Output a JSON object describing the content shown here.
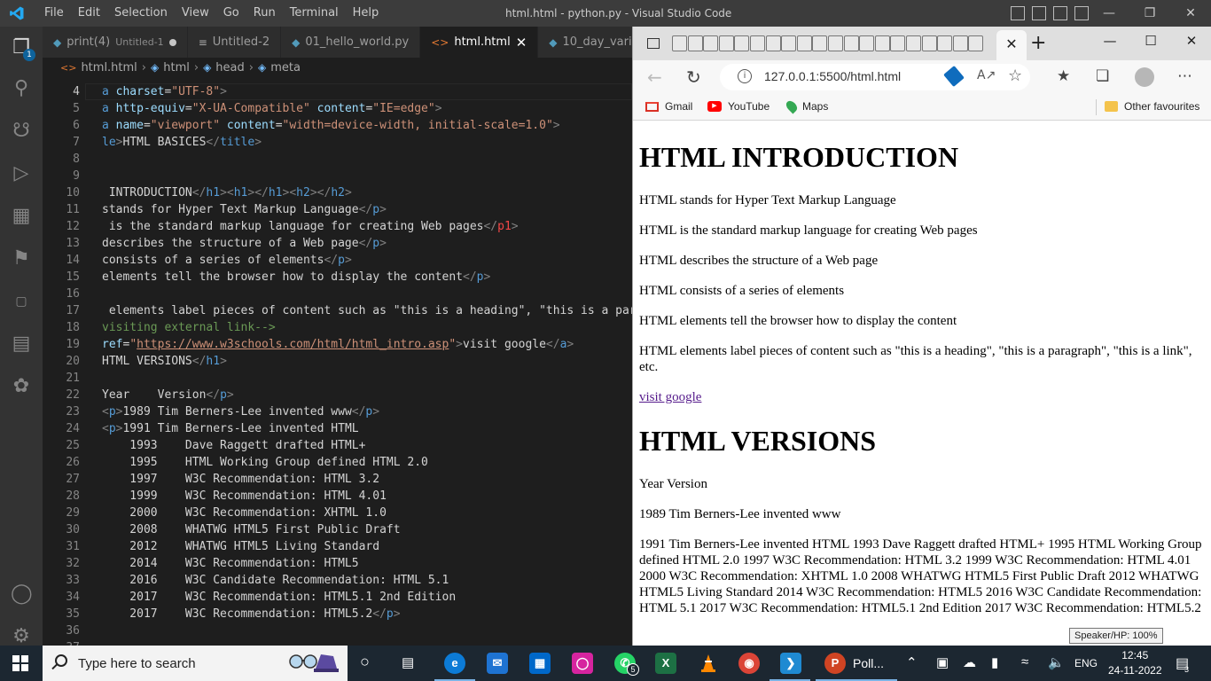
{
  "vscode": {
    "menu": [
      "File",
      "Edit",
      "Selection",
      "View",
      "Go",
      "Run",
      "Terminal",
      "Help"
    ],
    "window_title": "html.html - python.py - Visual Studio Code",
    "explorer_badge": "1",
    "tabs": [
      {
        "icon": "python-file-icon",
        "label": "print(4)",
        "sub": "Untitled-1",
        "state": "modified"
      },
      {
        "icon": "text-file-icon",
        "label": "Untitled-2"
      },
      {
        "icon": "python-file-icon",
        "label": "01_hello_world.py"
      },
      {
        "icon": "html-file-icon",
        "label": "html.html",
        "state": "active"
      },
      {
        "icon": "python-file-icon",
        "label": "10_day_vari"
      }
    ],
    "breadcrumb": [
      "html.html",
      "html",
      "head",
      "meta"
    ],
    "code_lines": [
      {
        "n": "4",
        "parts": [
          [
            "a",
            "t-name"
          ],
          [
            " charset",
            "t-attr"
          ],
          [
            "=",
            ""
          ],
          [
            "\"UTF-8\"",
            "t-str"
          ],
          [
            ">",
            "t-tag"
          ]
        ]
      },
      {
        "n": "5",
        "parts": [
          [
            "a",
            "t-name"
          ],
          [
            " http-equiv",
            "t-attr"
          ],
          [
            "=",
            ""
          ],
          [
            "\"X-UA-Compatible\"",
            "t-str"
          ],
          [
            " content",
            "t-attr"
          ],
          [
            "=",
            ""
          ],
          [
            "\"IE=edge\"",
            "t-str"
          ],
          [
            ">",
            "t-tag"
          ]
        ]
      },
      {
        "n": "6",
        "parts": [
          [
            "a",
            "t-name"
          ],
          [
            " name",
            "t-attr"
          ],
          [
            "=",
            ""
          ],
          [
            "\"viewport\"",
            "t-str"
          ],
          [
            " content",
            "t-attr"
          ],
          [
            "=",
            ""
          ],
          [
            "\"width=device-width, initial-scale=1.0\"",
            "t-str"
          ],
          [
            ">",
            "t-tag"
          ]
        ]
      },
      {
        "n": "7",
        "parts": [
          [
            "le",
            "t-name"
          ],
          [
            ">",
            "t-tag"
          ],
          [
            "HTML BASICES",
            ""
          ],
          [
            "</",
            "t-tag"
          ],
          [
            "title",
            "t-name"
          ],
          [
            ">",
            "t-tag"
          ]
        ]
      },
      {
        "n": "8",
        "parts": []
      },
      {
        "n": "9",
        "parts": []
      },
      {
        "n": "10",
        "parts": [
          [
            " INTRODUCTION",
            ""
          ],
          [
            "</",
            "t-tag"
          ],
          [
            "h1",
            "t-name"
          ],
          [
            ">",
            "t-tag"
          ],
          [
            "<",
            "t-tag"
          ],
          [
            "h1",
            "t-name"
          ],
          [
            ">",
            "t-tag"
          ],
          [
            "</",
            "t-tag"
          ],
          [
            "h1",
            "t-name"
          ],
          [
            ">",
            "t-tag"
          ],
          [
            "<",
            "t-tag"
          ],
          [
            "h2",
            "t-name"
          ],
          [
            ">",
            "t-tag"
          ],
          [
            "</",
            "t-tag"
          ],
          [
            "h2",
            "t-name"
          ],
          [
            ">",
            "t-tag"
          ]
        ]
      },
      {
        "n": "11",
        "parts": [
          [
            "stands for Hyper Text Markup Language",
            ""
          ],
          [
            "</",
            "t-tag"
          ],
          [
            "p",
            "t-name"
          ],
          [
            ">",
            "t-tag"
          ]
        ]
      },
      {
        "n": "12",
        "parts": [
          [
            " is the standard markup language for creating Web pages",
            ""
          ],
          [
            "</",
            "t-tag"
          ],
          [
            "p1",
            "t-err"
          ],
          [
            ">",
            "t-tag"
          ]
        ]
      },
      {
        "n": "13",
        "parts": [
          [
            "describes the structure of a Web page",
            ""
          ],
          [
            "</",
            "t-tag"
          ],
          [
            "p",
            "t-name"
          ],
          [
            ">",
            "t-tag"
          ]
        ]
      },
      {
        "n": "14",
        "parts": [
          [
            "consists of a series of elements",
            ""
          ],
          [
            "</",
            "t-tag"
          ],
          [
            "p",
            "t-name"
          ],
          [
            ">",
            "t-tag"
          ]
        ]
      },
      {
        "n": "15",
        "parts": [
          [
            "elements tell the browser how to display the content",
            ""
          ],
          [
            "</",
            "t-tag"
          ],
          [
            "p",
            "t-name"
          ],
          [
            ">",
            "t-tag"
          ]
        ]
      },
      {
        "n": "16",
        "parts": []
      },
      {
        "n": "17",
        "parts": [
          [
            " elements label pieces of content such as \"this is a heading\", \"this is a para",
            ""
          ]
        ]
      },
      {
        "n": "18",
        "parts": [
          [
            "visiting external link-->",
            "t-cmt"
          ]
        ]
      },
      {
        "n": "19",
        "parts": [
          [
            "ref",
            "t-attr"
          ],
          [
            "=",
            ""
          ],
          [
            "\"",
            "t-str"
          ],
          [
            "https://www.w3schools.com/html/html_intro.asp",
            "t-link"
          ],
          [
            "\"",
            "t-str"
          ],
          [
            ">",
            "t-tag"
          ],
          [
            "visit google",
            ""
          ],
          [
            "</",
            "t-tag"
          ],
          [
            "a",
            "t-name"
          ],
          [
            ">",
            "t-tag"
          ]
        ]
      },
      {
        "n": "20",
        "parts": [
          [
            "HTML VERSIONS",
            ""
          ],
          [
            "</",
            "t-tag"
          ],
          [
            "h1",
            "t-name"
          ],
          [
            ">",
            "t-tag"
          ]
        ]
      },
      {
        "n": "21",
        "parts": []
      },
      {
        "n": "22",
        "parts": [
          [
            "Year    Version",
            ""
          ],
          [
            "</",
            "t-tag"
          ],
          [
            "p",
            "t-name"
          ],
          [
            ">",
            "t-tag"
          ]
        ]
      },
      {
        "n": "23",
        "parts": [
          [
            "<",
            "t-tag"
          ],
          [
            "p",
            "t-name"
          ],
          [
            ">",
            "t-tag"
          ],
          [
            "1989 Tim Berners-Lee invented www",
            ""
          ],
          [
            "</",
            "t-tag"
          ],
          [
            "p",
            "t-name"
          ],
          [
            ">",
            "t-tag"
          ]
        ]
      },
      {
        "n": "24",
        "parts": [
          [
            "<",
            "t-tag"
          ],
          [
            "p",
            "t-name"
          ],
          [
            ">",
            "t-tag"
          ],
          [
            "1991 Tim Berners-Lee invented HTML",
            ""
          ]
        ]
      },
      {
        "n": "25",
        "parts": [
          [
            "    1993    Dave Raggett drafted HTML+",
            ""
          ]
        ]
      },
      {
        "n": "26",
        "parts": [
          [
            "    1995    HTML Working Group defined HTML 2.0",
            ""
          ]
        ]
      },
      {
        "n": "27",
        "parts": [
          [
            "    1997    W3C Recommendation: HTML 3.2",
            ""
          ]
        ]
      },
      {
        "n": "28",
        "parts": [
          [
            "    1999    W3C Recommendation: HTML 4.01",
            ""
          ]
        ]
      },
      {
        "n": "29",
        "parts": [
          [
            "    2000    W3C Recommendation: XHTML 1.0",
            ""
          ]
        ]
      },
      {
        "n": "30",
        "parts": [
          [
            "    2008    WHATWG HTML5 First Public Draft",
            ""
          ]
        ]
      },
      {
        "n": "31",
        "parts": [
          [
            "    2012    WHATWG HTML5 Living Standard",
            ""
          ]
        ]
      },
      {
        "n": "32",
        "parts": [
          [
            "    2014    W3C Recommendation: HTML5",
            ""
          ]
        ]
      },
      {
        "n": "33",
        "parts": [
          [
            "    2016    W3C Candidate Recommendation: HTML 5.1",
            ""
          ]
        ]
      },
      {
        "n": "34",
        "parts": [
          [
            "    2017    W3C Recommendation: HTML5.1 2nd Edition",
            ""
          ]
        ]
      },
      {
        "n": "35",
        "parts": [
          [
            "    2017    W3C Recommendation: HTML5.2",
            ""
          ],
          [
            "</",
            "t-tag"
          ],
          [
            "p",
            "t-name"
          ],
          [
            ">",
            "t-tag"
          ]
        ]
      },
      {
        "n": "36",
        "parts": []
      },
      {
        "n": "37",
        "parts": []
      }
    ]
  },
  "browser": {
    "url": "127.0.0.1:5500/html.html",
    "bookmarks": [
      "Gmail",
      "YouTube",
      "Maps"
    ],
    "other_favourites": "Other favourites",
    "page": {
      "h1_intro": "HTML INTRODUCTION",
      "p1": "HTML stands for Hyper Text Markup Language",
      "p2": "HTML is the standard markup language for creating Web pages",
      "p3": "HTML describes the structure of a Web page",
      "p4": "HTML consists of a series of elements",
      "p5": "HTML elements tell the browser how to display the content",
      "p6": "HTML elements label pieces of content such as \"this is a heading\", \"this is a paragraph\", \"this is a link\", etc.",
      "link": "visit google",
      "h1_versions": "HTML VERSIONS",
      "p7": "Year Version",
      "p8": "1989 Tim Berners-Lee invented www",
      "p9": "1991 Tim Berners-Lee invented HTML 1993 Dave Raggett drafted HTML+ 1995 HTML Working Group defined HTML 2.0 1997 W3C Recommendation: HTML 3.2 1999 W3C Recommendation: HTML 4.01 2000 W3C Recommendation: XHTML 1.0 2008 WHATWG HTML5 First Public Draft 2012 WHATWG HTML5 Living Standard 2014 W3C Recommendation: HTML5 2016 W3C Candidate Recommendation: HTML 5.1 2017 W3C Recommendation: HTML5.1 2nd Edition 2017 W3C Recommendation: HTML5.2"
    },
    "tooltip": "Speaker/HP: 100%"
  },
  "taskbar": {
    "search_placeholder": "Type here to search",
    "whatsapp_badge": "5",
    "pinned_app_label": "Poll...",
    "language": "ENG",
    "time": "12:45",
    "date": "24-11-2022",
    "notification_count": "3",
    "colors": {
      "edge": "#0c7bd6",
      "mail": "#1e73d2",
      "store": "#0068c9",
      "instagram": "#d6249f",
      "whatsapp": "#25d366",
      "excel": "#1d7044",
      "vlc": "#ff8800",
      "chrome": "#db4437",
      "vscode": "#1f8ad2",
      "powerpoint": "#d04423"
    }
  }
}
